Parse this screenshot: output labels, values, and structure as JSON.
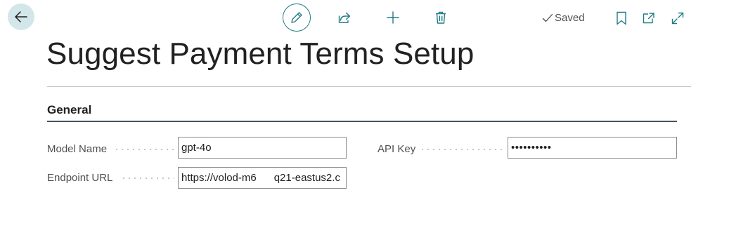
{
  "toolbar": {
    "back_icon": "arrow-left-icon",
    "edit_icon": "pencil-icon",
    "share_icon": "share-icon",
    "new_icon": "plus-icon",
    "delete_icon": "trash-icon",
    "saved_label": "Saved",
    "bookmark_icon": "bookmark-icon",
    "popout_icon": "open-in-new-window-icon",
    "expand_icon": "expand-icon"
  },
  "page": {
    "title": "Suggest Payment Terms Setup"
  },
  "general": {
    "heading": "General",
    "fields": {
      "model_name": {
        "label": "Model Name",
        "value": "gpt-4o"
      },
      "endpoint_url": {
        "label": "Endpoint URL",
        "value": "https://volod-m6      q21-eastus2.c"
      },
      "api_key": {
        "label": "API Key",
        "value": "••••••••••"
      }
    }
  },
  "colors": {
    "accent": "#1f7c86",
    "back_button_bg": "#d3e7ea",
    "section_divider": "#47525d"
  }
}
